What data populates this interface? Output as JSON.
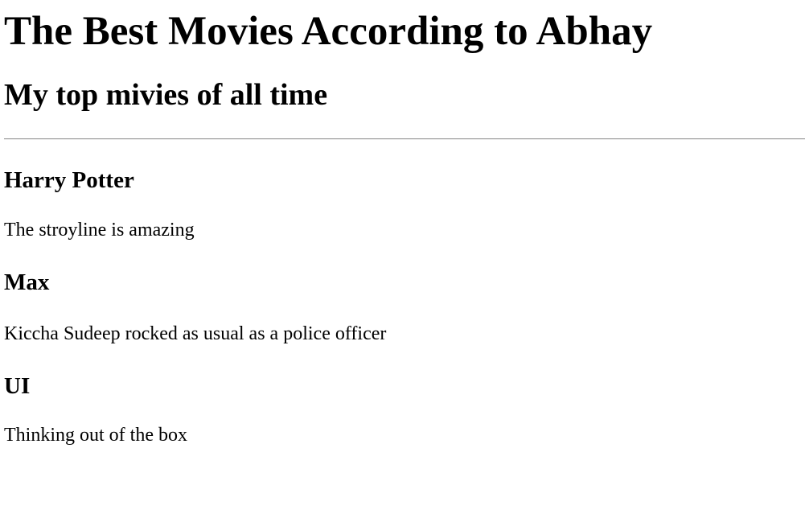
{
  "page": {
    "title": "The Best Movies According to Abhay",
    "subtitle": "My top mivies of all time"
  },
  "movies": [
    {
      "title": "Harry Potter",
      "description": "The stroyline is amazing"
    },
    {
      "title": "Max",
      "description": "Kiccha Sudeep rocked as usual as a police officer"
    },
    {
      "title": "UI",
      "description": "Thinking out of the box"
    }
  ]
}
